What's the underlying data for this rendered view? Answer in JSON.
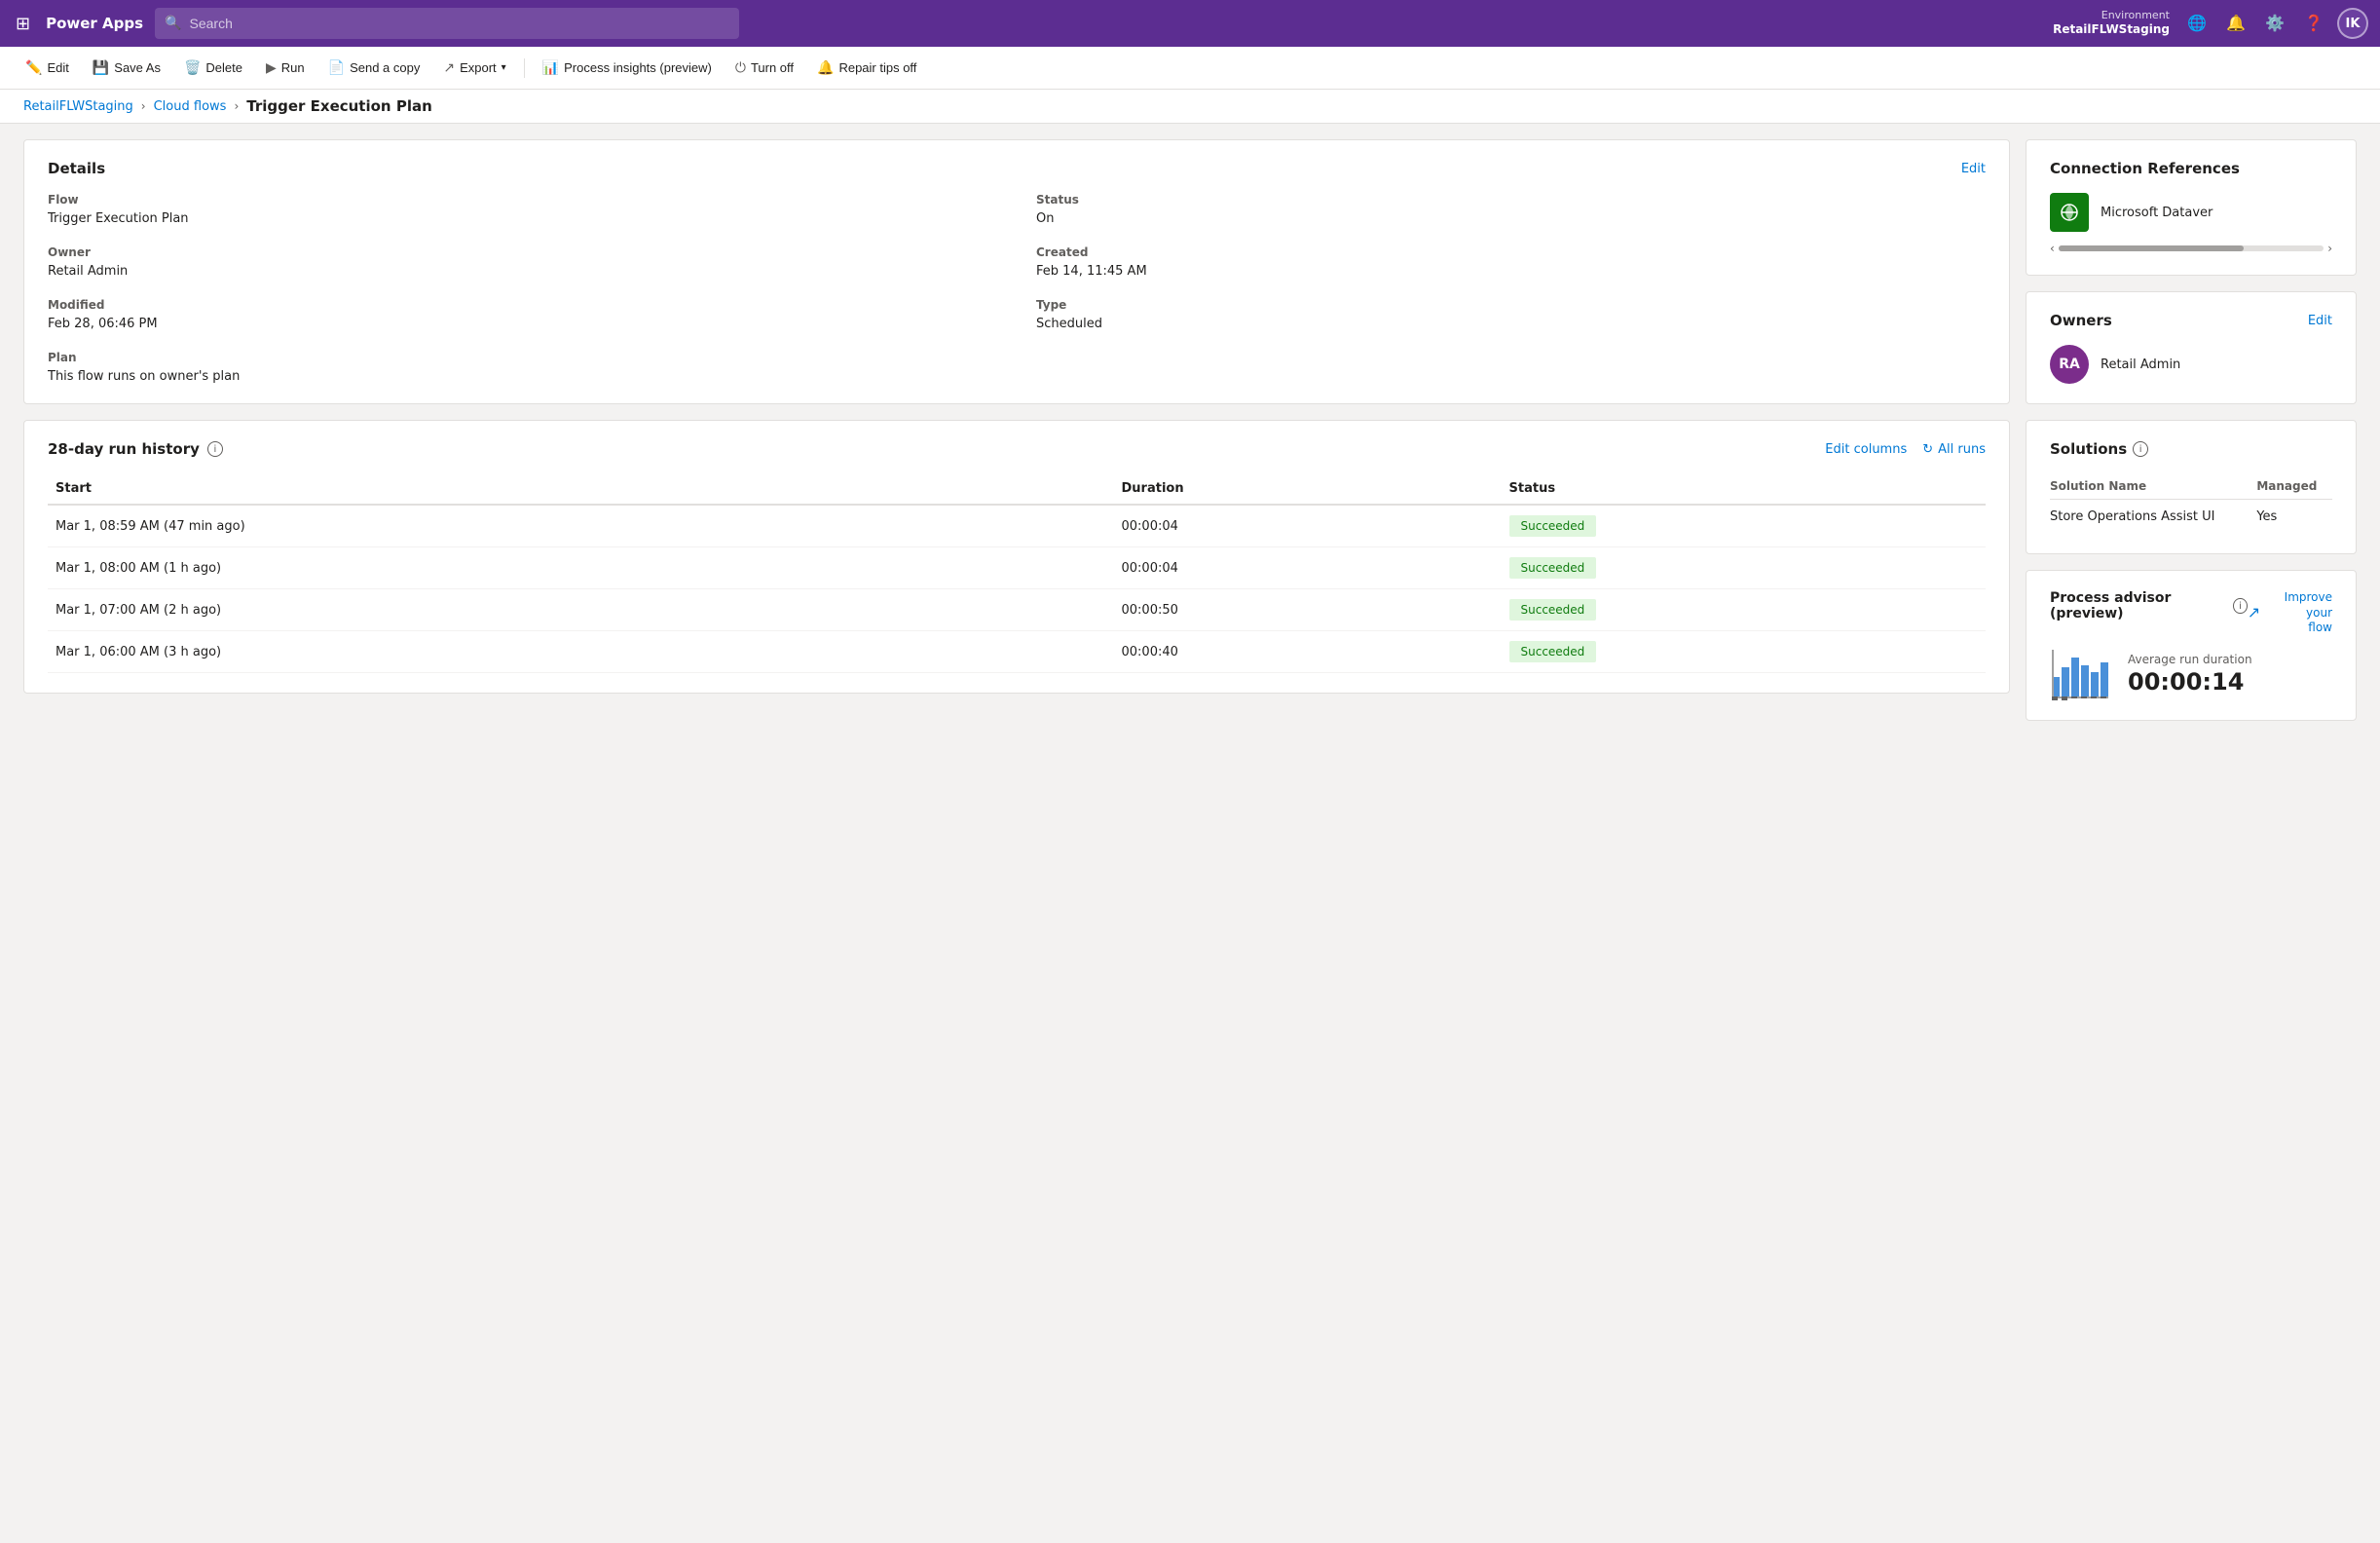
{
  "nav": {
    "waffle_icon": "⊞",
    "logo": "Power Apps",
    "search_placeholder": "Search",
    "env_label": "Environment",
    "env_name": "RetailFLWStaging",
    "avatar_initials": "IK"
  },
  "toolbar": {
    "edit_label": "Edit",
    "save_as_label": "Save As",
    "delete_label": "Delete",
    "run_label": "Run",
    "send_copy_label": "Send a copy",
    "export_label": "Export",
    "process_insights_label": "Process insights (preview)",
    "turn_off_label": "Turn off",
    "repair_tips_label": "Repair tips off"
  },
  "breadcrumb": {
    "env": "RetailFLWStaging",
    "cloud_flows": "Cloud flows",
    "current": "Trigger Execution Plan"
  },
  "details": {
    "card_title": "Details",
    "edit_label": "Edit",
    "flow_label": "Flow",
    "flow_value": "Trigger Execution Plan",
    "owner_label": "Owner",
    "owner_value": "Retail Admin",
    "status_label": "Status",
    "status_value": "On",
    "created_label": "Created",
    "created_value": "Feb 14, 11:45 AM",
    "modified_label": "Modified",
    "modified_value": "Feb 28, 06:46 PM",
    "type_label": "Type",
    "type_value": "Scheduled",
    "plan_label": "Plan",
    "plan_value": "This flow runs on owner's plan"
  },
  "history": {
    "title": "28-day run history",
    "edit_columns": "Edit columns",
    "all_runs": "All runs",
    "col_start": "Start",
    "col_duration": "Duration",
    "col_status": "Status",
    "runs": [
      {
        "start": "Mar 1, 08:59 AM (47 min ago)",
        "duration": "00:00:04",
        "status": "Succeeded"
      },
      {
        "start": "Mar 1, 08:00 AM (1 h ago)",
        "duration": "00:00:04",
        "status": "Succeeded"
      },
      {
        "start": "Mar 1, 07:00 AM (2 h ago)",
        "duration": "00:00:50",
        "status": "Succeeded"
      },
      {
        "start": "Mar 1, 06:00 AM (3 h ago)",
        "duration": "00:00:40",
        "status": "Succeeded"
      }
    ]
  },
  "connection_references": {
    "title": "Connection References",
    "name": "Microsoft Dataver"
  },
  "owners": {
    "title": "Owners",
    "edit_label": "Edit",
    "owner_initials": "RA",
    "owner_name": "Retail Admin"
  },
  "solutions": {
    "title": "Solutions",
    "col_name": "Solution Name",
    "col_managed": "Managed",
    "items": [
      {
        "name": "Store Operations Assist UI",
        "managed": "Yes"
      }
    ]
  },
  "process_advisor": {
    "title": "Process advisor (preview)",
    "improve_label": "Improve your\nflow",
    "avg_label": "Average run duration",
    "avg_value": "00:00:14"
  }
}
